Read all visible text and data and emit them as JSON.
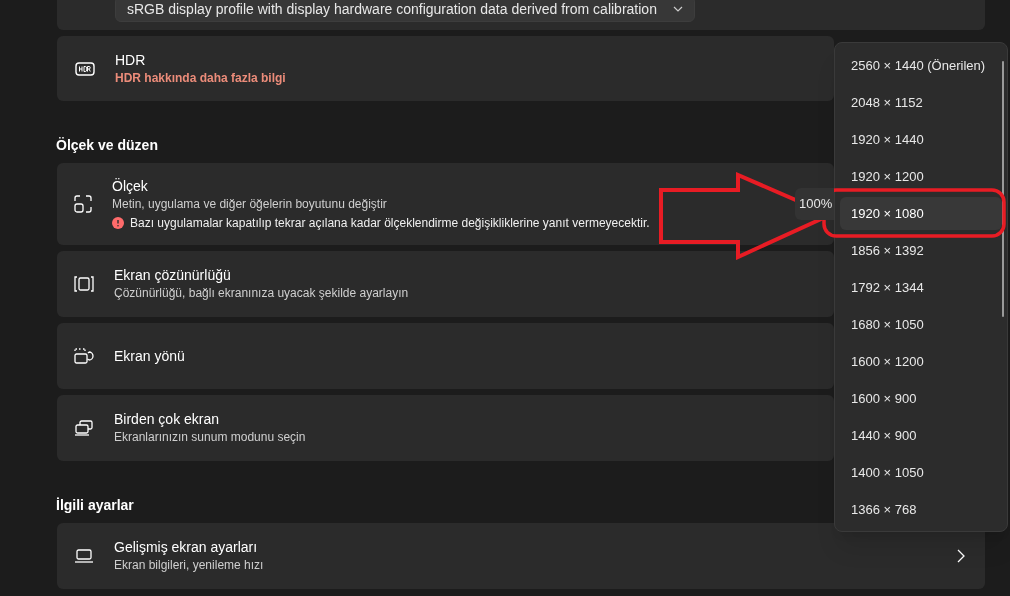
{
  "color_profile": {
    "value": "sRGB display profile with display hardware configuration data derived from calibration"
  },
  "hdr": {
    "title": "HDR",
    "link": "HDR hakkında daha fazla bilgi"
  },
  "sections": [
    {
      "heading": "Ölçek ve düzen",
      "items": [
        {
          "kind": "scale",
          "title": "Ölçek",
          "subtitle": "Metin, uygulama ve diğer öğelerin boyutunu değiştir",
          "warning": "Bazı uygulamalar kapatılıp tekrar açılana kadar ölçeklendirme değişikliklerine yanıt vermeyecektir.",
          "value": "100%"
        },
        {
          "kind": "resolution",
          "title": "Ekran çözünürlüğü",
          "subtitle": "Çözünürlüğü, bağlı ekranınıza uyacak şekilde ayarlayın"
        },
        {
          "kind": "orientation",
          "title": "Ekran yönü"
        },
        {
          "kind": "multi_display",
          "title": "Birden çok ekran",
          "subtitle": "Ekranlarınızın sunum modunu seçin"
        }
      ]
    },
    {
      "heading": "İlgili ayarlar",
      "items": [
        {
          "kind": "advanced",
          "title": "Gelişmiş ekran ayarları",
          "subtitle": "Ekran bilgileri, yenileme hızı"
        }
      ]
    }
  ],
  "resolution_menu": {
    "options": [
      {
        "label": "2560 × 1440 (Önerilen)",
        "selected": false
      },
      {
        "label": "2048 × 1152",
        "selected": false
      },
      {
        "label": "1920 × 1440",
        "selected": false
      },
      {
        "label": "1920 × 1200",
        "selected": false
      },
      {
        "label": "1920 × 1080",
        "selected": true
      },
      {
        "label": "1856 × 1392",
        "selected": false
      },
      {
        "label": "1792 × 1344",
        "selected": false
      },
      {
        "label": "1680 × 1050",
        "selected": false
      },
      {
        "label": "1600 × 1200",
        "selected": false
      },
      {
        "label": "1600 × 900",
        "selected": false
      },
      {
        "label": "1440 × 900",
        "selected": false
      },
      {
        "label": "1400 × 1050",
        "selected": false
      },
      {
        "label": "1366 × 768",
        "selected": false
      }
    ]
  }
}
